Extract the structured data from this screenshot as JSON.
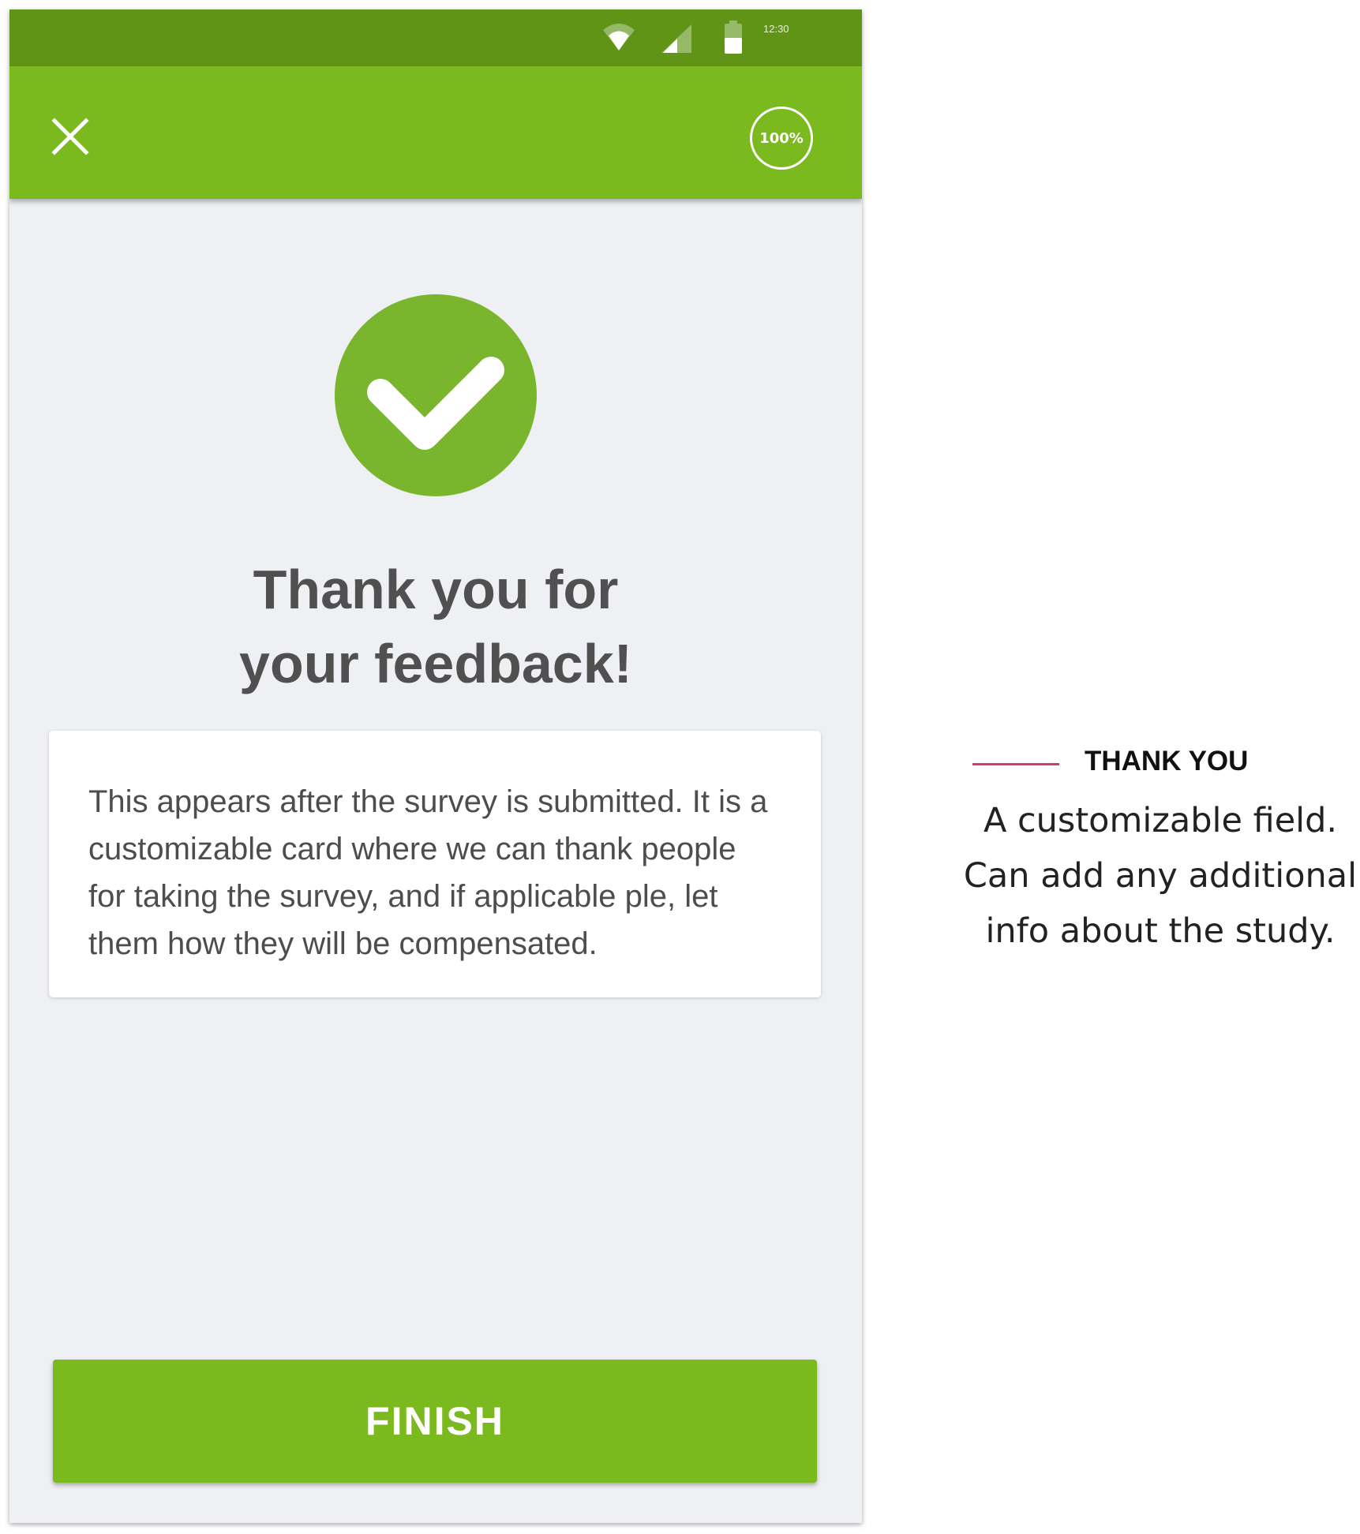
{
  "status_bar": {
    "time": "12:30",
    "icons": [
      "wifi-icon",
      "signal-icon",
      "battery-icon"
    ]
  },
  "app_bar": {
    "close_icon": "close-icon",
    "progress_label": "100%"
  },
  "main": {
    "success_icon": "checkmark-icon",
    "title_line1": "Thank you for",
    "title_line2": "your feedback!",
    "card_text": "This appears after the survey is submitted. It is a customizable card where we can thank people for taking the survey, and if applicable ple, let them how they will be compensated.",
    "finish_label": "FINISH"
  },
  "annotation": {
    "title": "THANK YOU",
    "line1": "A customizable field.",
    "line2": "Can add any additional",
    "line3": "info about the study."
  },
  "colors": {
    "app_bar": "#7aba1f",
    "status_bar": "#5f9417",
    "background": "#eff0f4",
    "accent_line": "#d43a6b"
  }
}
